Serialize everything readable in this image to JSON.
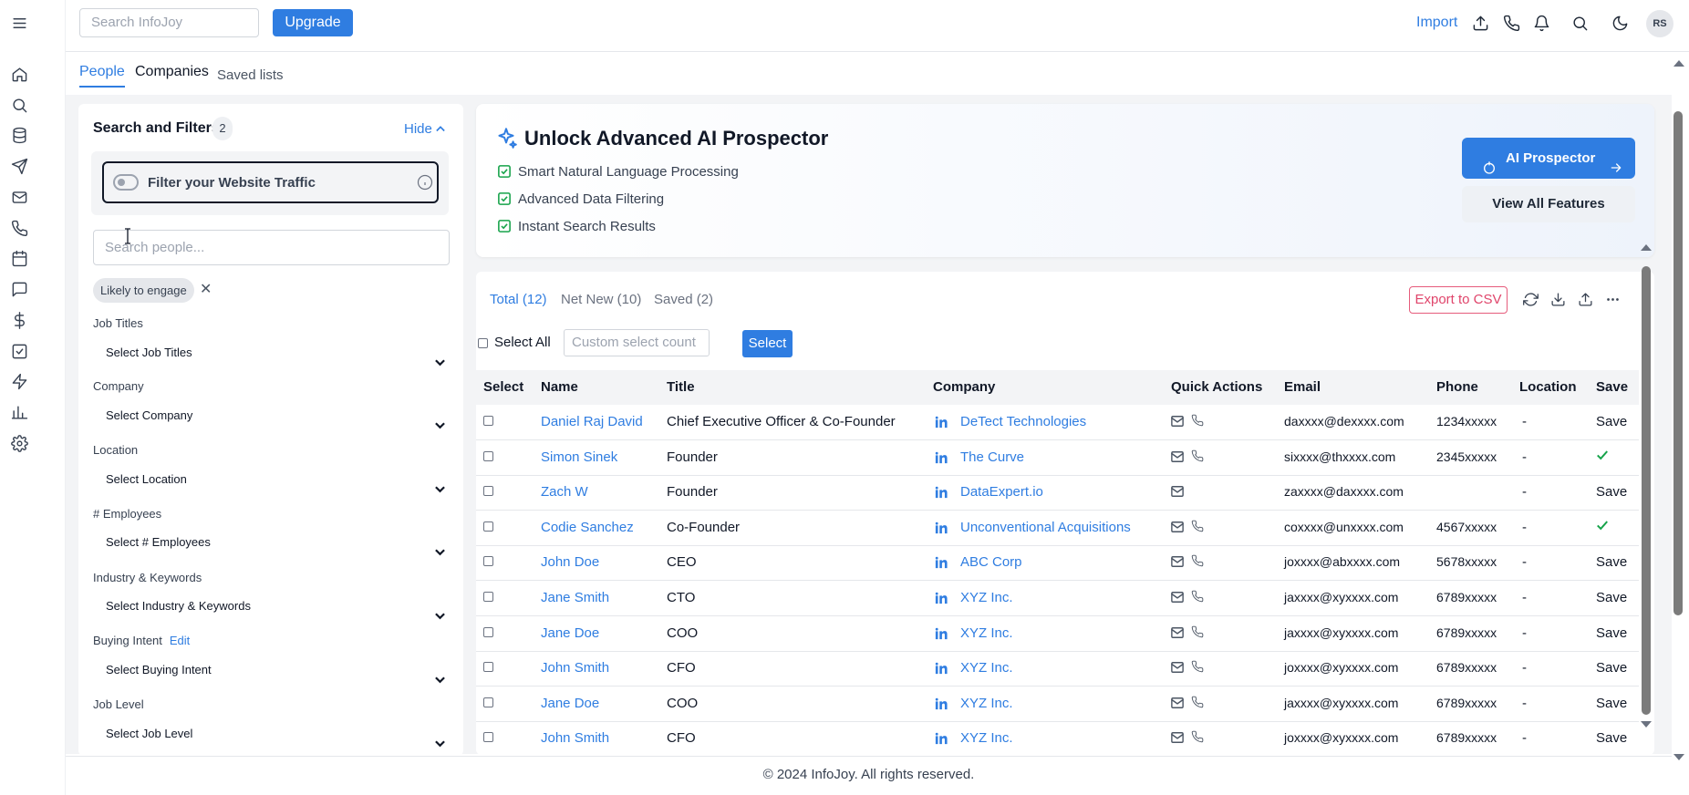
{
  "sidebar": {
    "icons": [
      "menu-icon",
      "home-icon",
      "search-icon",
      "database-icon",
      "send-icon",
      "mail-icon",
      "phone-icon",
      "calendar-icon",
      "chat-icon",
      "dollar-icon",
      "task-icon",
      "zap-icon",
      "chart-icon",
      "settings-icon"
    ]
  },
  "topbar": {
    "search_placeholder": "Search InfoJoy",
    "upgrade_label": "Upgrade",
    "import_label": "Import",
    "avatar_initials": "RS"
  },
  "tabs": [
    {
      "label": "People",
      "active": true
    },
    {
      "label": "Companies",
      "active": false
    },
    {
      "label": "Saved lists",
      "active": false
    }
  ],
  "filters": {
    "title": "Search and Filters",
    "count": "2",
    "hide_label": "Hide",
    "web_traffic_label": "Filter your Website Traffic",
    "search_placeholder": "Search people...",
    "chip": "Likely to engage",
    "fields": [
      {
        "label": "Job Titles",
        "placeholder": "Select Job Titles"
      },
      {
        "label": "Company",
        "placeholder": "Select Company"
      },
      {
        "label": "Location",
        "placeholder": "Select Location"
      },
      {
        "label": "# Employees",
        "placeholder": "Select # Employees"
      },
      {
        "label": "Industry & Keywords",
        "placeholder": "Select Industry & Keywords"
      },
      {
        "label": "Buying Intent",
        "edit": "Edit",
        "placeholder": "Select Buying Intent"
      },
      {
        "label": "Job Level",
        "placeholder": "Select Job Level"
      }
    ]
  },
  "banner": {
    "title": "Unlock Advanced AI Prospector",
    "features": [
      "Smart Natural Language Processing",
      "Advanced Data Filtering",
      "Instant Search Results"
    ],
    "primary_button": "AI Prospector",
    "secondary_button": "View All Features"
  },
  "results": {
    "tabs": [
      {
        "label": "Total (12)",
        "active": true
      },
      {
        "label": "Net New (10)",
        "active": false
      },
      {
        "label": "Saved (2)",
        "active": false
      }
    ],
    "export_label": "Export to CSV",
    "select_all_label": "Select All",
    "count_placeholder": "Custom select count",
    "select_button": "Select",
    "columns": [
      "Select",
      "Name",
      "Title",
      "Company",
      "Quick Actions",
      "Email",
      "Phone",
      "Location",
      "Save"
    ],
    "rows": [
      {
        "name": "Daniel Raj David",
        "title": "Chief Executive Officer & Co-Founder",
        "company": "DeTect Technologies",
        "phone_action": true,
        "email": "daxxxx@dexxxx.com",
        "phone": "1234xxxxx",
        "location": "-",
        "save": "Save"
      },
      {
        "name": "Simon Sinek",
        "title": "Founder",
        "company": "The Curve",
        "phone_action": true,
        "email": "sixxxx@thxxxx.com",
        "phone": "2345xxxxx",
        "location": "-",
        "save": "saved"
      },
      {
        "name": "Zach W",
        "title": "Founder",
        "company": "DataExpert.io",
        "phone_action": false,
        "email": "zaxxxx@daxxxx.com",
        "phone": "",
        "location": "-",
        "save": "Save"
      },
      {
        "name": "Codie Sanchez",
        "title": "Co-Founder",
        "company": "Unconventional Acquisitions",
        "phone_action": true,
        "email": "coxxxx@unxxxx.com",
        "phone": "4567xxxxx",
        "location": "-",
        "save": "saved"
      },
      {
        "name": "John Doe",
        "title": "CEO",
        "company": "ABC Corp",
        "phone_action": true,
        "email": "joxxxx@abxxxx.com",
        "phone": "5678xxxxx",
        "location": "-",
        "save": "Save"
      },
      {
        "name": "Jane Smith",
        "title": "CTO",
        "company": "XYZ Inc.",
        "phone_action": true,
        "email": "jaxxxx@xyxxxx.com",
        "phone": "6789xxxxx",
        "location": "-",
        "save": "Save"
      },
      {
        "name": "Jane Doe",
        "title": "COO",
        "company": "XYZ Inc.",
        "phone_action": true,
        "email": "jaxxxx@xyxxxx.com",
        "phone": "6789xxxxx",
        "location": "-",
        "save": "Save"
      },
      {
        "name": "John Smith",
        "title": "CFO",
        "company": "XYZ Inc.",
        "phone_action": true,
        "email": "joxxxx@xyxxxx.com",
        "phone": "6789xxxxx",
        "location": "-",
        "save": "Save"
      },
      {
        "name": "Jane Doe",
        "title": "COO",
        "company": "XYZ Inc.",
        "phone_action": true,
        "email": "jaxxxx@xyxxxx.com",
        "phone": "6789xxxxx",
        "location": "-",
        "save": "Save"
      },
      {
        "name": "John Smith",
        "title": "CFO",
        "company": "XYZ Inc.",
        "phone_action": true,
        "email": "joxxxx@xyxxxx.com",
        "phone": "6789xxxxx",
        "location": "-",
        "save": "Save"
      }
    ]
  },
  "footer": {
    "text": "© 2024 InfoJoy. All rights reserved."
  },
  "colors": {
    "accent": "#2f7de1",
    "export": "#e0456b",
    "check": "#16a34a"
  }
}
